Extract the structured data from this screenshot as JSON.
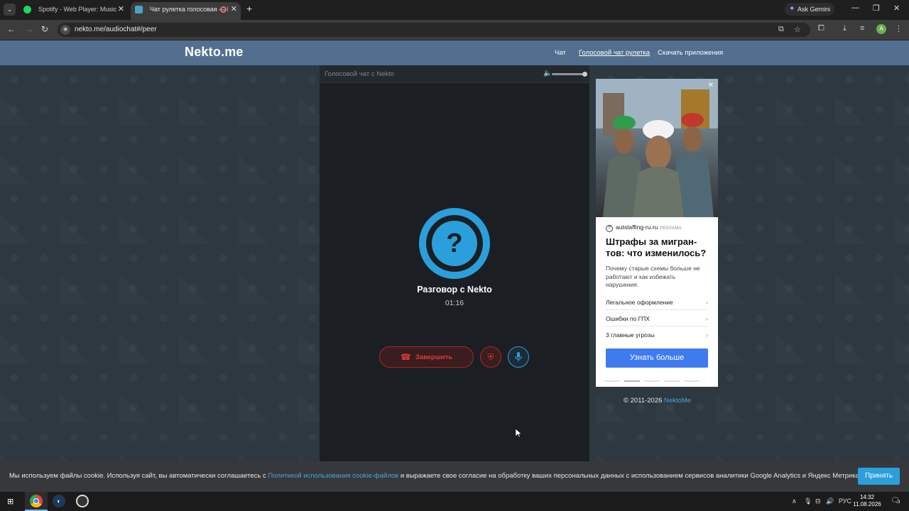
{
  "browser": {
    "tabs": [
      {
        "title": "Spotify - Web Player: Music for everyone"
      },
      {
        "title": "Чат рулетка голосовая — Nekto.me"
      }
    ],
    "gemini_label": "Ask Gemini",
    "url": "nekto.me/audiochat#/peer"
  },
  "site": {
    "logo": "Nekto.me",
    "nav": {
      "chat": "Чат",
      "voice_chat": "Голосовой чат рулетка",
      "download": "Скачать приложения"
    }
  },
  "chat": {
    "header_title": "Голосовой чат с Nekto",
    "avatar_symbol": "?",
    "peer_name": "Разговор с Nekto",
    "timer": "01:16",
    "end_label": "Завершить",
    "accent_color": "#2b9fdb",
    "danger_color": "#e53935"
  },
  "ad": {
    "source": "autstaffing-ru.ru",
    "label": "РЕКЛАМА",
    "title": "Штрафы за мигран-тов: что изменилось?",
    "description": "Почему старые схемы больше не работают и как избежать нарушения.",
    "items": [
      "Легальное оформление",
      "Ошибки по ГПХ",
      "3 главные угрозы"
    ],
    "cta": "Узнать больше"
  },
  "footer": {
    "copyright": "© 2011-2026",
    "brand_link": "NektoMe"
  },
  "cookie": {
    "text_before": "Мы используем файлы cookie. Используя сайт, вы автоматически соглашаетесь с",
    "link": "Политикой использования cookie-файлов",
    "text_after": "и выражаете свое согласие на обработку ваших персональных данных с использованием сервисов аналитики Google Analytics и Яндекс Метрика.",
    "accept": "Принять"
  },
  "taskbar": {
    "lang": "РУС",
    "time": "14:32",
    "date": "11.08.2026",
    "notifications": "3"
  }
}
